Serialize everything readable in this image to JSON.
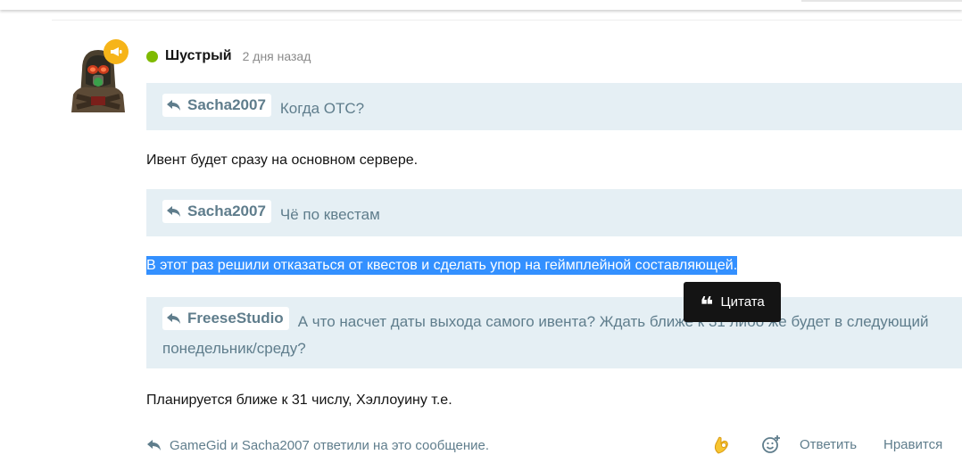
{
  "post": {
    "author": "Шустрый",
    "time": "2 дня назад",
    "blocks": [
      {
        "type": "quote",
        "author": "Sacha2007",
        "text": "Когда ОТС?"
      },
      {
        "type": "text",
        "text": "Ивент будет сразу на основном сервере."
      },
      {
        "type": "quote",
        "author": "Sacha2007",
        "text": "Чё по квестам"
      },
      {
        "type": "text",
        "text": "В этот раз решили отказаться от квестов и сделать упор на геймплейной составляющей."
      },
      {
        "type": "quote",
        "author": "FreeseStudio",
        "text": "А что насчет даты выхода самого ивента? Ждать ближе к 31 либо же будет в следующий понедельник/среду?"
      },
      {
        "type": "text",
        "text": "Планируется ближе к 31 числу, Хэллоуину т.е."
      }
    ],
    "replied_text": "GameGid и Sacha2007 ответили на это сообщение.",
    "reply_label": "Ответить",
    "like_label": "Нравится"
  },
  "tooltip": {
    "icon": "quote-icon",
    "label": "Цитата"
  },
  "colors": {
    "online": "#7fba00",
    "badge": "#f6b419",
    "quote_bg": "#e5eff4",
    "quote_text": "#5f7d8c",
    "selection": "#3390ff"
  }
}
